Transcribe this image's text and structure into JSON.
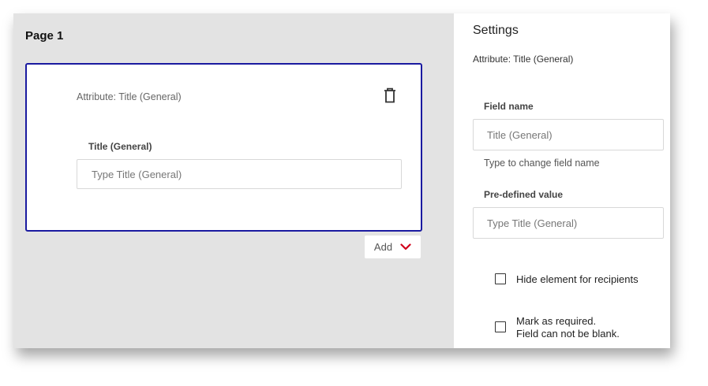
{
  "canvas": {
    "page_title": "Page 1",
    "card": {
      "attribute_text": "Attribute: Title (General)",
      "delete_icon": "trash-icon",
      "field_label": "Title (General)",
      "field_placeholder": "Type Title (General)",
      "field_value": ""
    },
    "add_button": {
      "label": "Add",
      "icon": "chevron-down-icon",
      "icon_color": "#d0021b"
    }
  },
  "settings": {
    "title": "Settings",
    "attribute_text": "Attribute: Title (General)",
    "field_name": {
      "label": "Field name",
      "placeholder": "Title (General)",
      "value": "",
      "hint": "Type to change field name"
    },
    "predefined_value": {
      "label": "Pre-defined value",
      "placeholder": "Type Title (General)",
      "value": ""
    },
    "hide_element": {
      "label": "Hide element for recipients",
      "checked": false
    },
    "mark_required": {
      "label_line1": "Mark as required.",
      "label_line2": "Field can not be blank.",
      "checked": false
    }
  },
  "colors": {
    "card_border": "#1a1aa0",
    "canvas_background": "#e3e3e3",
    "accent_chevron": "#d0021b"
  }
}
